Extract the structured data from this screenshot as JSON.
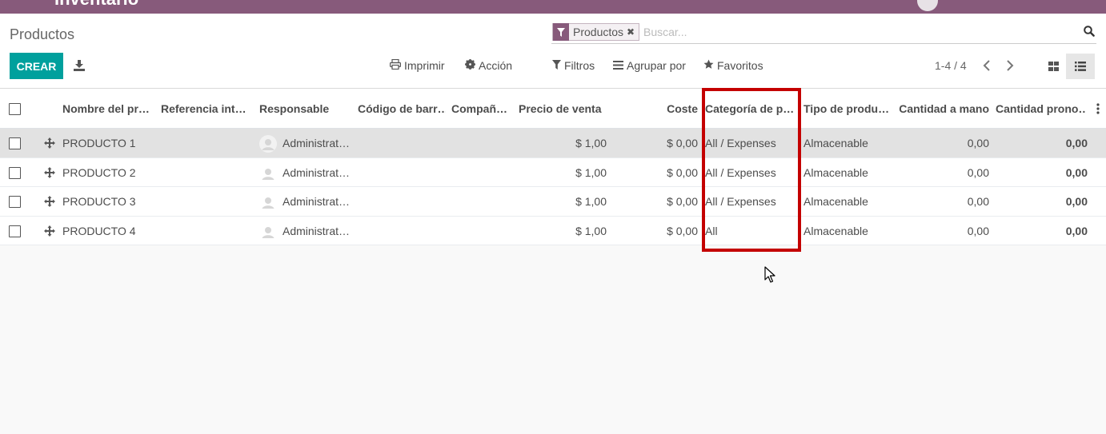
{
  "topbar": {
    "app_title": "Inventario"
  },
  "control_panel": {
    "title": "Productos",
    "search": {
      "facet_label": "Productos",
      "facet_remove": "✖",
      "placeholder": "Buscar..."
    },
    "create_label": "CREAR",
    "print_label": "Imprimir",
    "action_label": "Acción",
    "filters_label": "Filtros",
    "group_by_label": "Agrupar por",
    "favorites_label": "Favoritos",
    "pager": "1-4 / 4"
  },
  "table": {
    "columns": [
      "Nombre del pr…",
      "Referencia int…",
      "Responsable",
      "Código de barr…",
      "Compañ…",
      "Precio de venta",
      "Coste",
      "Categoría de p…",
      "Tipo de produ…",
      "Cantidad a mano",
      "Cantidad prono…"
    ],
    "rows": [
      {
        "name": "PRODUCTO 1",
        "responsible": "Administrat…",
        "price": "$ 1,00",
        "cost": "$ 0,00",
        "category": "All / Expenses",
        "type": "Almacenable",
        "qty": "0,00",
        "forecast": "0,00"
      },
      {
        "name": "PRODUCTO 2",
        "responsible": "Administrat…",
        "price": "$ 1,00",
        "cost": "$ 0,00",
        "category": "All / Expenses",
        "type": "Almacenable",
        "qty": "0,00",
        "forecast": "0,00"
      },
      {
        "name": "PRODUCTO 3",
        "responsible": "Administrat…",
        "price": "$ 1,00",
        "cost": "$ 0,00",
        "category": "All / Expenses",
        "type": "Almacenable",
        "qty": "0,00",
        "forecast": "0,00"
      },
      {
        "name": "PRODUCTO 4",
        "responsible": "Administrat…",
        "price": "$ 1,00",
        "cost": "$ 0,00",
        "category": "All",
        "type": "Almacenable",
        "qty": "0,00",
        "forecast": "0,00"
      }
    ]
  },
  "colors": {
    "brand": "#875a7b",
    "primary": "#00a09d",
    "highlight": "#c40000"
  },
  "icons": [
    "filter-icon",
    "search-icon",
    "download-icon",
    "print-icon",
    "gear-icon",
    "list-icon",
    "star-icon",
    "chevron-left-icon",
    "chevron-right-icon",
    "kanban-icon",
    "list-view-icon",
    "drag-handle-icon",
    "avatar-icon",
    "kebab-icon",
    "mouse-cursor-icon"
  ]
}
